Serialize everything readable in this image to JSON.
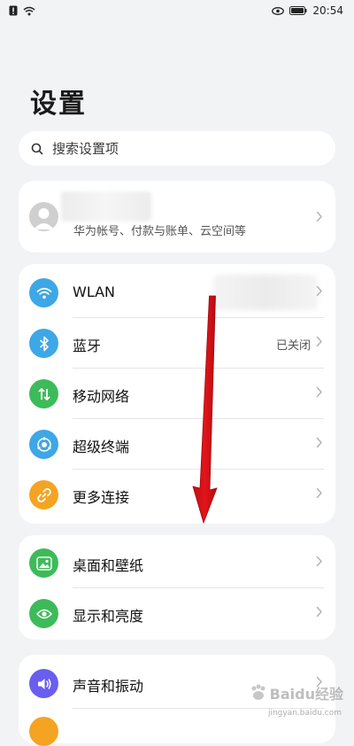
{
  "status_bar": {
    "time": "20:54"
  },
  "page": {
    "title": "设置"
  },
  "search": {
    "placeholder": "搜索设置项"
  },
  "account": {
    "subtitle": "华为帐号、付款与账单、云空间等"
  },
  "network": {
    "items": [
      {
        "label": "WLAN",
        "value": "",
        "icon": "wifi-icon",
        "color": "#3ea7e6"
      },
      {
        "label": "蓝牙",
        "value": "已关闭",
        "icon": "bluetooth-icon",
        "color": "#3ea7e6"
      },
      {
        "label": "移动网络",
        "value": "",
        "icon": "mobile-data-icon",
        "color": "#3dbb5a"
      },
      {
        "label": "超级终端",
        "value": "",
        "icon": "super-device-icon",
        "color": "#3ea7e6"
      },
      {
        "label": "更多连接",
        "value": "",
        "icon": "link-icon",
        "color": "#f4a422"
      }
    ]
  },
  "display": {
    "items": [
      {
        "label": "桌面和壁纸",
        "icon": "wallpaper-icon",
        "color": "#3dbb5a"
      },
      {
        "label": "显示和亮度",
        "icon": "eye-icon",
        "color": "#3dbb5a"
      }
    ]
  },
  "sound": {
    "items": [
      {
        "label": "声音和振动",
        "icon": "speaker-icon",
        "color": "#6a5ef0"
      }
    ]
  },
  "colors": {
    "arrow": "#e3141b",
    "background": "#f1f3f5",
    "card": "#ffffff"
  },
  "watermark": {
    "text": "Baidu经验",
    "sub": "jingyan.baidu.com"
  }
}
